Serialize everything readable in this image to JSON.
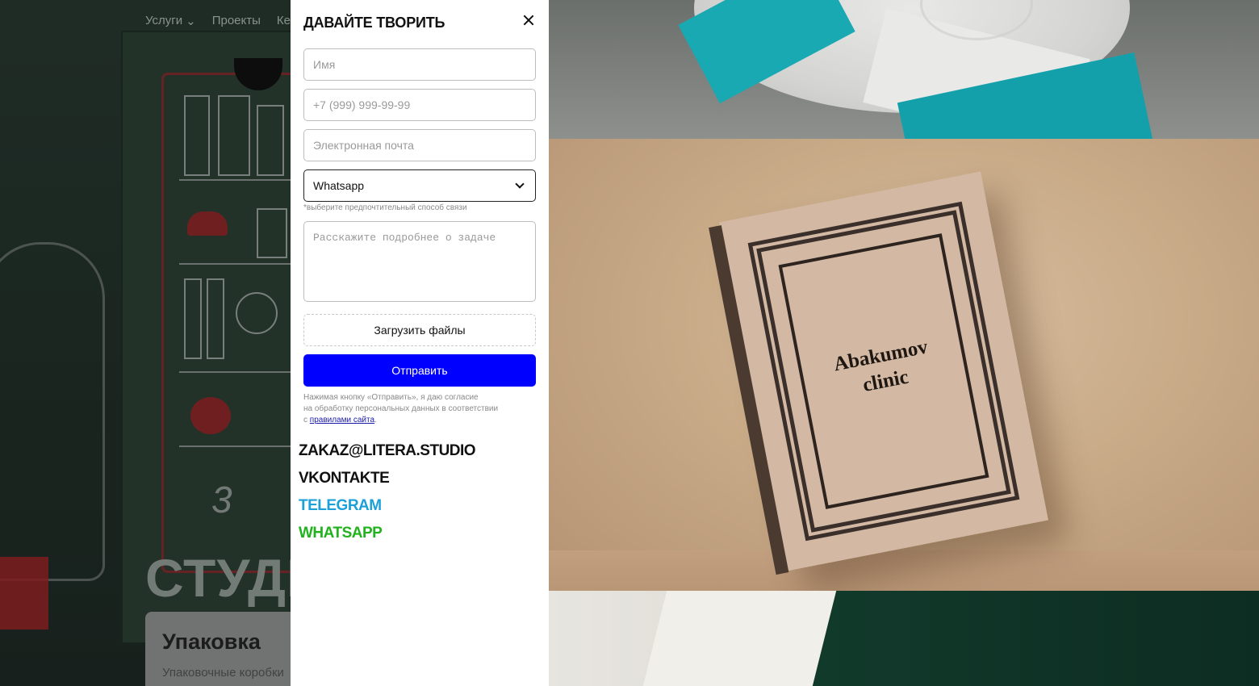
{
  "background": {
    "nav": [
      "Услуги",
      "Проекты",
      "Кей"
    ],
    "hero_title": "СТУДИ",
    "card": {
      "title": "Упаковка",
      "subtitle": "Упаковочные коробки"
    },
    "advent_number": "3"
  },
  "gallery": {
    "book_title_line1": "Abakumov",
    "book_title_line2": "clinic"
  },
  "modal": {
    "title": "ДАВАЙТЕ ТВОРИТЬ",
    "name_placeholder": "Имя",
    "phone_placeholder": "+7 (999) 999-99-99",
    "email_placeholder": "Электронная почта",
    "contact_method": {
      "selected": "Whatsapp",
      "hint": "*выберите предпочтительный способ связи"
    },
    "message_placeholder": "Расскажите подробнее о задаче",
    "upload_label": "Загрузить файлы",
    "submit_label": "Отправить",
    "consent_line1": "Нажимая кнопку «Отправить», я даю согласие",
    "consent_line2": "на обработку персональных данных в соответствии",
    "consent_prefix": "с ",
    "consent_link": "правилами сайта",
    "consent_suffix": "."
  },
  "contacts": {
    "email": "ZAKAZ@LITERA.STUDIO",
    "vk": "VKONTAKTE",
    "telegram": "TELEGRAM",
    "whatsapp": "WHATSAPP"
  },
  "colors": {
    "submit_bg": "#0000ff",
    "telegram": "#1ba0d8",
    "whatsapp": "#21b21e"
  },
  "icons": [
    "close-icon",
    "chevron-down-icon"
  ]
}
